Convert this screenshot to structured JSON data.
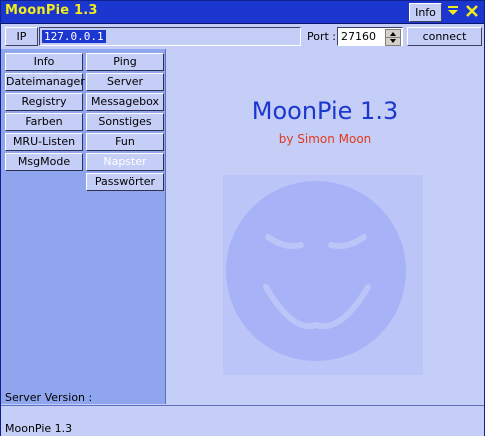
{
  "window": {
    "title": "MoonPie 1.3",
    "info_label": "Info",
    "minimize_icon": "arrow-down-icon",
    "close_icon": "close-icon"
  },
  "connection": {
    "ip_label": "IP",
    "ip_value": "127.0.0.1",
    "port_label": "Port :",
    "port_value": "27160",
    "connect_label": "connect"
  },
  "nav": {
    "left": [
      "Info",
      "Dateimanager",
      "Registry",
      "Farben",
      "MRU-Listen",
      "MsgMode"
    ],
    "right": [
      "Ping",
      "Server",
      "Messagebox",
      "Sonstiges",
      "Fun",
      "Napster",
      "Passwörter"
    ],
    "disabled": [
      "Napster"
    ]
  },
  "server_version_label": "Server Version :",
  "main": {
    "title": "MoonPie 1.3",
    "subtitle": "by Simon Moon",
    "logo_icon": "smiley-face-icon"
  },
  "status": {
    "text": "MoonPie 1.3"
  },
  "colors": {
    "titlebar": "#1c37d0",
    "title_text": "#f2ec18",
    "accent_blue": "#1c37d0",
    "subtitle_red": "#e03a1c",
    "panel_bg": "#8fa5ee",
    "window_bg": "#c4cef7"
  }
}
